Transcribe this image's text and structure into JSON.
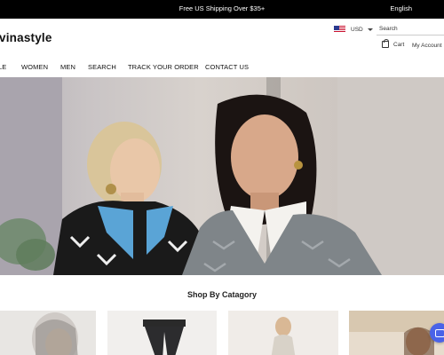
{
  "topbar": {
    "shipping_text": "Free US Shipping Over $35+",
    "language": "English"
  },
  "header": {
    "logo_text": "vinastyle",
    "currency": "USD",
    "search_placeholder": "Search",
    "cart_label": "Cart",
    "account_label": "My Account"
  },
  "nav": {
    "items": [
      {
        "label": "LE"
      },
      {
        "label": "WOMEN"
      },
      {
        "label": "MEN"
      },
      {
        "label": "SEARCH"
      },
      {
        "label": "TRACK YOUR ORDER"
      },
      {
        "label": "CONTACT US"
      }
    ]
  },
  "section": {
    "title": "Shop By Catagory"
  },
  "icons": {
    "cart": "shopping-bag-icon",
    "currency": "us-flag-icon",
    "chat": "chat-icon"
  }
}
